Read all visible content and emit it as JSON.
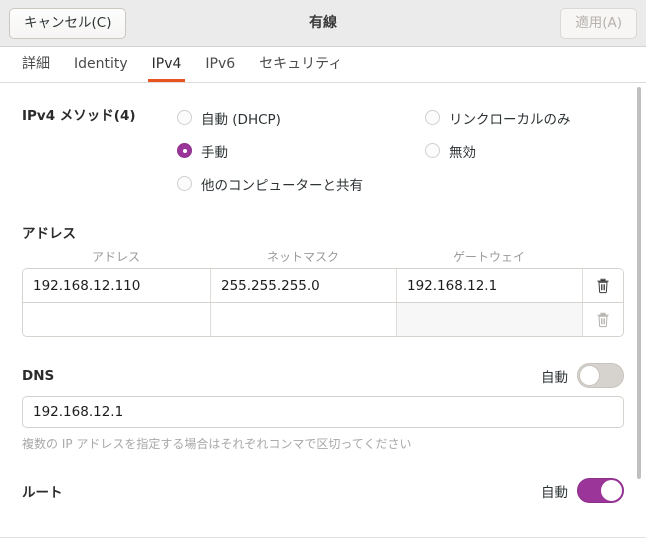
{
  "titlebar": {
    "cancel_label": "キャンセル(C)",
    "title": "有線",
    "apply_label": "適用(A)"
  },
  "tabs": [
    {
      "label": "詳細",
      "active": false
    },
    {
      "label": "Identity",
      "active": false
    },
    {
      "label": "IPv4",
      "active": true
    },
    {
      "label": "IPv6",
      "active": false
    },
    {
      "label": "セキュリティ",
      "active": false
    }
  ],
  "method": {
    "label": "IPv4 メソッド(4)",
    "left_options": [
      {
        "label": "自動 (DHCP)",
        "selected": false
      },
      {
        "label": "手動",
        "selected": true
      },
      {
        "label": "他のコンピューターと共有",
        "selected": false
      }
    ],
    "right_options": [
      {
        "label": "リンクローカルのみ",
        "selected": false
      },
      {
        "label": "無効",
        "selected": false
      }
    ]
  },
  "addresses": {
    "title": "アドレス",
    "columns": [
      "アドレス",
      "ネットマスク",
      "ゲートウェイ"
    ],
    "rows": [
      {
        "address": "192.168.12.110",
        "netmask": "255.255.255.0",
        "gateway": "192.168.12.1",
        "delete_icon": "trash-icon",
        "enabled": true
      },
      {
        "address": "",
        "netmask": "",
        "gateway": "",
        "delete_icon": "trash-icon",
        "enabled": false
      }
    ]
  },
  "dns": {
    "title": "DNS",
    "auto_label": "自動",
    "auto_on": false,
    "value": "192.168.12.1",
    "hint": "複数の IP アドレスを指定する場合はそれぞれコンマで区切ってください"
  },
  "routes": {
    "title": "ルート",
    "auto_label": "自動",
    "auto_on": true
  },
  "colors": {
    "accent_orange": "#e95420",
    "accent_purple": "#9b359a",
    "header_bg": "#ebebeb"
  }
}
